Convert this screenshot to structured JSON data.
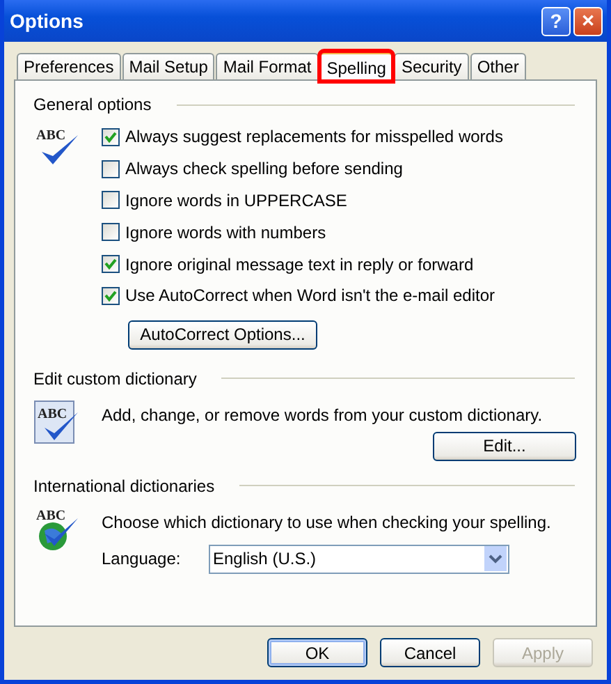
{
  "window": {
    "title": "Options"
  },
  "title_buttons": [
    {
      "kind": "help",
      "label": "?"
    },
    {
      "kind": "close",
      "label": "✕"
    }
  ],
  "tabs": [
    {
      "label": "Preferences",
      "selected": false,
      "highlighted": false
    },
    {
      "label": "Mail Setup",
      "selected": false,
      "highlighted": false
    },
    {
      "label": "Mail Format",
      "selected": false,
      "highlighted": false
    },
    {
      "label": "Spelling",
      "selected": true,
      "highlighted": true
    },
    {
      "label": "Security",
      "selected": false,
      "highlighted": false
    },
    {
      "label": "Other",
      "selected": false,
      "highlighted": false
    }
  ],
  "general": {
    "heading": "General options",
    "icon_text": "ABC",
    "options": [
      {
        "label": "Always suggest replacements for misspelled words",
        "checked": true
      },
      {
        "label": "Always check spelling before sending",
        "checked": false
      },
      {
        "label": "Ignore words in UPPERCASE",
        "checked": false
      },
      {
        "label": "Ignore words with numbers",
        "checked": false
      },
      {
        "label": "Ignore original message text in reply or forward",
        "checked": true
      },
      {
        "label": "Use AutoCorrect when Word isn't the e-mail editor",
        "checked": true
      }
    ],
    "button": "AutoCorrect Options..."
  },
  "custom": {
    "heading": "Edit custom dictionary",
    "icon_text": "ABC",
    "text": "Add, change, or remove words from your custom dictionary.",
    "button": "Edit..."
  },
  "international": {
    "heading": "International dictionaries",
    "icon_text": "ABC",
    "text": "Choose which dictionary to use when checking your spelling.",
    "language_label": "Language:",
    "language_value": "English (U.S.)"
  },
  "buttons": [
    {
      "label": "OK",
      "disabled": false,
      "default": true
    },
    {
      "label": "Cancel",
      "disabled": false,
      "default": false
    },
    {
      "label": "Apply",
      "disabled": true,
      "default": false
    }
  ]
}
